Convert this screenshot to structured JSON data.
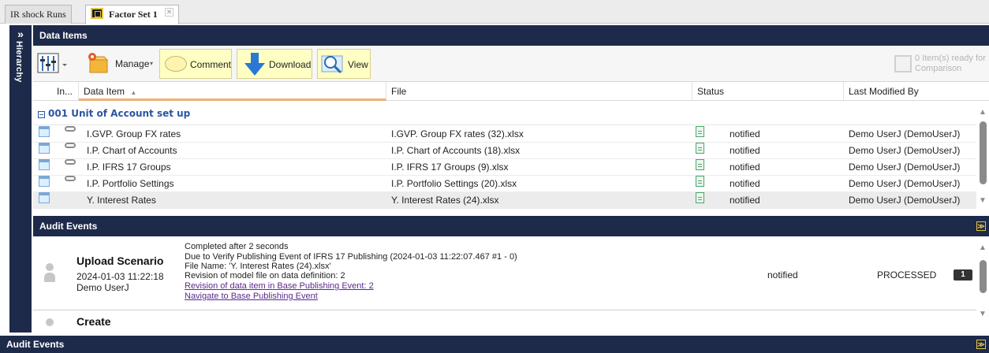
{
  "tabs": [
    {
      "label": "IR shock Runs",
      "active": false
    },
    {
      "label": "Factor Set 1",
      "active": true,
      "close": "✕"
    }
  ],
  "sidebar": {
    "collapse_icon": "»",
    "label": "Hierarchy"
  },
  "data_items": {
    "header": "Data Items",
    "toolbar": {
      "columns_icon": "column-chooser-icon",
      "manage_label": "Manage",
      "comment_label": "Comment",
      "download_label": "Download",
      "view_label": "View",
      "ready_text": "0 Item(s) ready for Comparison"
    },
    "columns": [
      "In...",
      "Data Item",
      "File",
      "Status",
      "Last Modified By"
    ],
    "sort_indicator": "▲",
    "group": {
      "label": "001 Unit of Account set up",
      "expander": "⊟"
    },
    "rows": [
      {
        "name": "I.GVP. Group FX rates",
        "file": "I.GVP. Group FX rates (32).xlsx",
        "status": "notified",
        "by": "Demo UserJ (DemoUserJ)",
        "linked": true,
        "selected": false
      },
      {
        "name": "I.P. Chart of Accounts",
        "file": "I.P. Chart of Accounts (18).xlsx",
        "status": "notified",
        "by": "Demo UserJ (DemoUserJ)",
        "linked": true,
        "selected": false
      },
      {
        "name": "I.P. IFRS 17 Groups",
        "file": "I.P. IFRS 17 Groups (9).xlsx",
        "status": "notified",
        "by": "Demo UserJ (DemoUserJ)",
        "linked": true,
        "selected": false
      },
      {
        "name": "I.P. Portfolio Settings",
        "file": "I.P. Portfolio Settings (20).xlsx",
        "status": "notified",
        "by": "Demo UserJ (DemoUserJ)",
        "linked": true,
        "selected": false
      },
      {
        "name": "Y. Interest Rates",
        "file": "Y. Interest Rates (24).xlsx",
        "status": "notified",
        "by": "Demo UserJ (DemoUserJ)",
        "linked": false,
        "selected": true
      }
    ]
  },
  "audit_events": {
    "header": "Audit Events",
    "collapse_icon": "≫",
    "event": {
      "title": "Upload Scenario",
      "timestamp": "2024-01-03 11:22:18",
      "user": "Demo UserJ",
      "lines": [
        "Completed after 2 seconds",
        "Due to Verify Publishing Event of IFRS 17 Publishing (2024-01-03 11:22:07.467 #1 - 0)",
        "File Name: 'Y. Interest Rates (24).xlsx'",
        "Revision of model file on data definition: 2"
      ],
      "links": [
        "Revision of data item in Base Publishing Event: 2",
        "Navigate to Base Publishing Event"
      ],
      "status": "notified",
      "state": "PROCESSED",
      "count": "1"
    },
    "next_event_title": "Create"
  },
  "bottom_panel": {
    "header": "Audit Events",
    "collapse_icon": "≫"
  }
}
